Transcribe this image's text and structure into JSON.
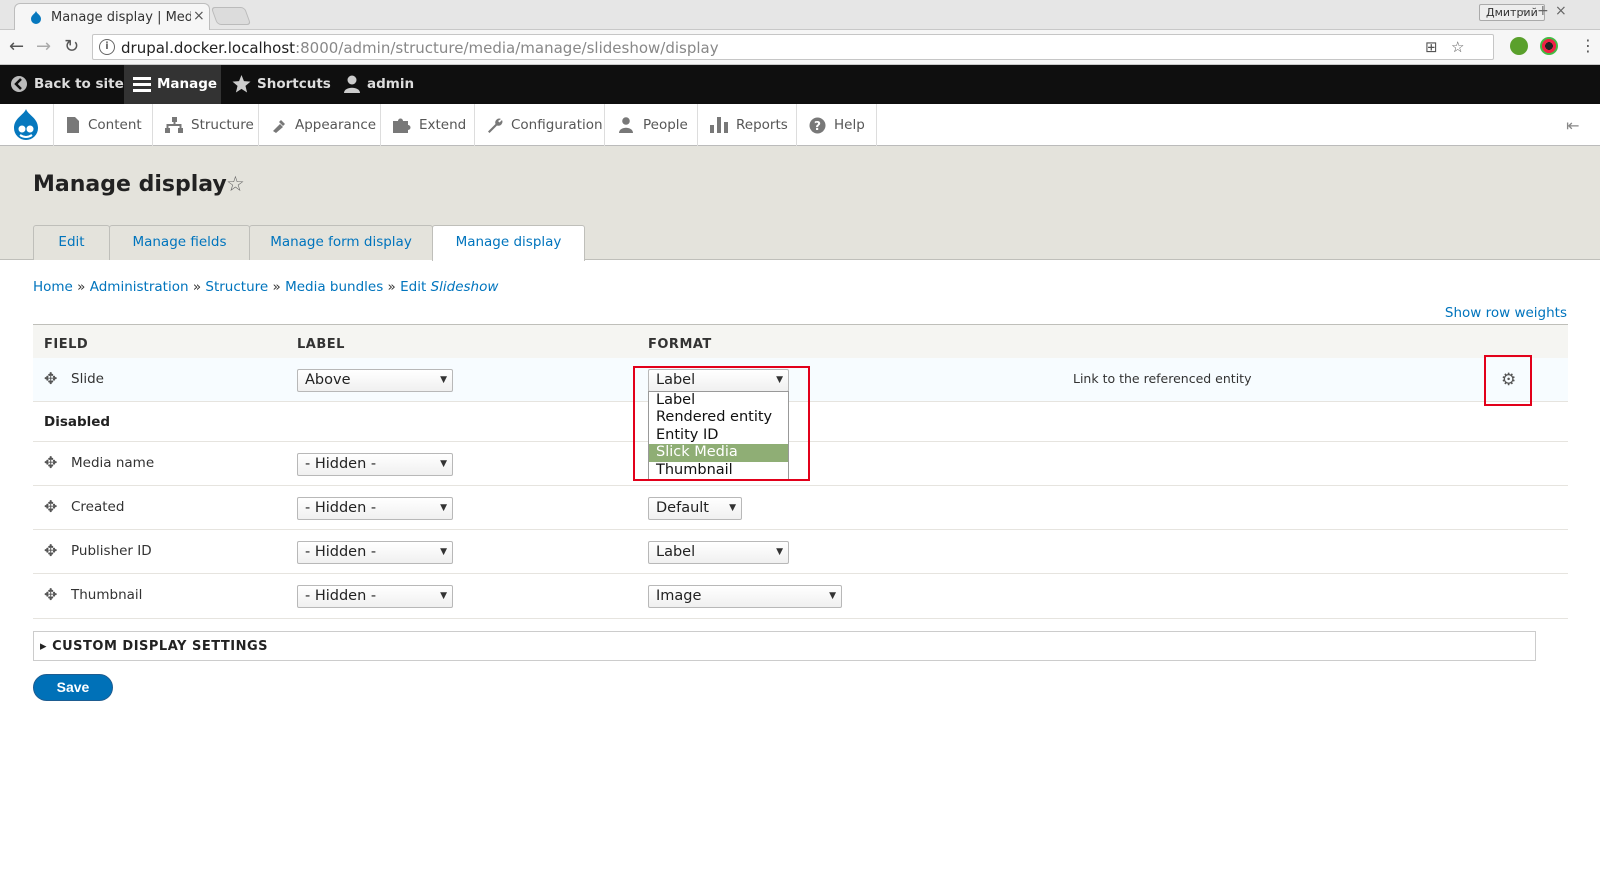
{
  "browser": {
    "tab_title": "Manage display | Medi",
    "tab_close": "×",
    "profile": "Дмитрий",
    "window_controls": [
      "–",
      "+",
      "×"
    ],
    "url_host": "drupal.docker.localhost",
    "url_path": ":8000/admin/structure/media/manage/slideshow/display",
    "back": "←",
    "forward": "→",
    "reload": "↻",
    "menu": "⋮"
  },
  "toolbar": {
    "back_to_site": "Back to site",
    "manage": "Manage",
    "shortcuts": "Shortcuts",
    "user": "admin"
  },
  "tray": {
    "items": [
      "Content",
      "Structure",
      "Appearance",
      "Extend",
      "Configuration",
      "People",
      "Reports",
      "Help"
    ]
  },
  "page": {
    "title": "Manage display",
    "tabs": [
      "Edit",
      "Manage fields",
      "Manage form display",
      "Manage display"
    ],
    "active_tab": "Manage display"
  },
  "breadcrumb": {
    "items": [
      "Home",
      "Administration",
      "Structure",
      "Media bundles"
    ],
    "edit_prefix": "Edit",
    "edit_item": "Slideshow",
    "separator": "»"
  },
  "show_row_weights": "Show row weights",
  "table": {
    "headers": {
      "field": "FIELD",
      "label": "LABEL",
      "format": "FORMAT"
    },
    "slide_row": {
      "name": "Slide",
      "label_value": "Above",
      "format_value": "Label",
      "summary": "Link to the referenced entity"
    },
    "disabled_label": "Disabled",
    "disabled_rows": [
      {
        "name": "Media name",
        "label_value": "- Hidden -",
        "format_value": ""
      },
      {
        "name": "Created",
        "label_value": "- Hidden -",
        "format_value": "Default"
      },
      {
        "name": "Publisher ID",
        "label_value": "- Hidden -",
        "format_value": "Label"
      },
      {
        "name": "Thumbnail",
        "label_value": "- Hidden -",
        "format_value": "Image"
      }
    ]
  },
  "format_dropdown": {
    "options": [
      "Label",
      "Rendered entity",
      "Entity ID",
      "Slick Media",
      "Thumbnail"
    ],
    "highlighted": "Slick Media"
  },
  "custom_display_settings": "CUSTOM DISPLAY SETTINGS",
  "save_label": "Save",
  "colors": {
    "link": "#0074bd",
    "primary_button": "#0071b8",
    "highlight": "#8fae75",
    "annotation": "#e2001a"
  }
}
